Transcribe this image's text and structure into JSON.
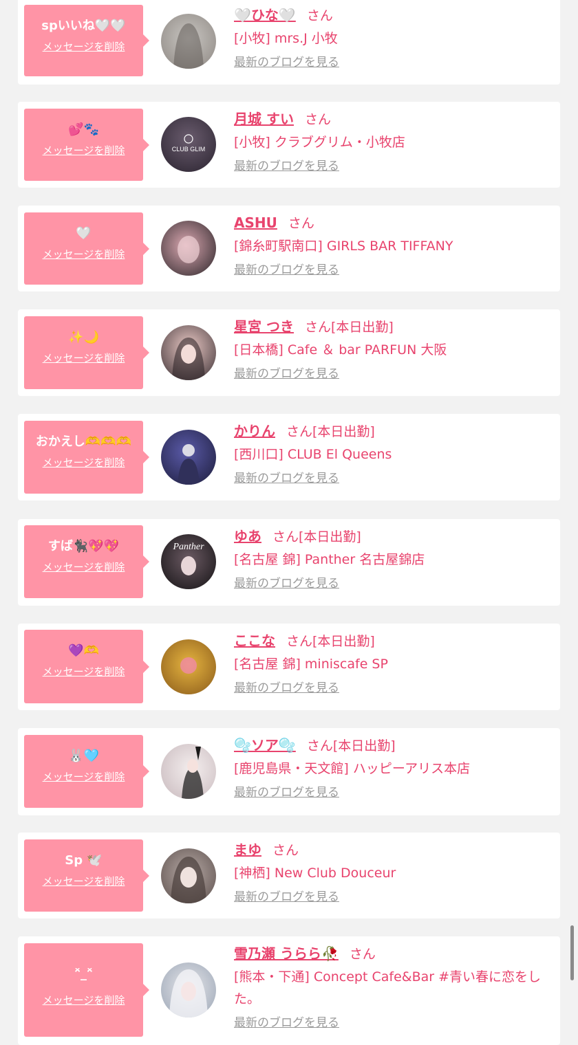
{
  "colors": {
    "background": "#f2f2f2",
    "card": "#ffffff",
    "bubble": "#ff94a6",
    "name": "#e8436d",
    "blog_link": "#9a9a9a"
  },
  "delete_label": "メッセージを削除",
  "blog_label": "最新のブログを見る",
  "san_label": "さん",
  "items": [
    {
      "message": "spいいね🤍🤍",
      "name": "🤍ひな🤍",
      "status": "",
      "shop": "[小牧] mrs.J 小牧",
      "avatar_colors": [
        "#c9c6c2",
        "#8d8782"
      ]
    },
    {
      "message": "💕🐾",
      "name": "月城 すい",
      "status": "",
      "shop": "[小牧] クラブグリム・小牧店",
      "avatar_text": "CLUB GLIM",
      "avatar_colors": [
        "#6a5c6e",
        "#2b2430"
      ]
    },
    {
      "message": "🤍",
      "name": "ASHU",
      "status": "",
      "shop": "[錦糸町駅南口] GIRLS BAR TIFFANY",
      "avatar_colors": [
        "#d9a7b0",
        "#2a2428"
      ]
    },
    {
      "message": "✨🌙",
      "name": "星宮 つき",
      "status": "[本日出勤]",
      "shop": "[日本橋] Cafe ＆ bar PARFUN 大阪",
      "avatar_colors": [
        "#e9c8c4",
        "#3a2f33"
      ]
    },
    {
      "message": "おかえし🫶🫶🫶",
      "name": "かりん",
      "status": "[本日出勤]",
      "shop": "[西川口] CLUB El Queens",
      "avatar_colors": [
        "#5a5aa8",
        "#1c1c3a"
      ]
    },
    {
      "message": "すば🐈‍⬛💖💖",
      "name": "ゆあ",
      "status": "[本日出勤]",
      "shop": "[名古屋 錦] Panther 名古屋錦店",
      "avatar_text": "Panther",
      "avatar_colors": [
        "#6b5a63",
        "#141214"
      ]
    },
    {
      "message": "💜🫶",
      "name": "ここな",
      "status": "[本日出勤]",
      "shop": "[名古屋 錦] miniscafe SP",
      "avatar_colors": [
        "#e5b440",
        "#8a5a1a"
      ]
    },
    {
      "message": "🐰🩵",
      "name": "🫧ソア🫧",
      "status": "[本日出勤]",
      "shop": "[鹿児島県・天文館] ハッピーアリス本店",
      "avatar_colors": [
        "#f4eeee",
        "#c7b8bc"
      ]
    },
    {
      "message": "Sp 🕊️",
      "name": "まゆ",
      "status": "",
      "shop": "[神栖] New Club Douceur",
      "avatar_colors": [
        "#b7aaa6",
        "#5c4f4c"
      ]
    },
    {
      "message": "ᵔ̆_ᵔ̆",
      "name": "雪乃瀬 うらら🥀",
      "status": "",
      "shop": "[熊本・下通] Concept Cafe&Bar #青い春に恋をした。",
      "avatar_colors": [
        "#e6e6ea",
        "#9aa5b5"
      ]
    }
  ]
}
